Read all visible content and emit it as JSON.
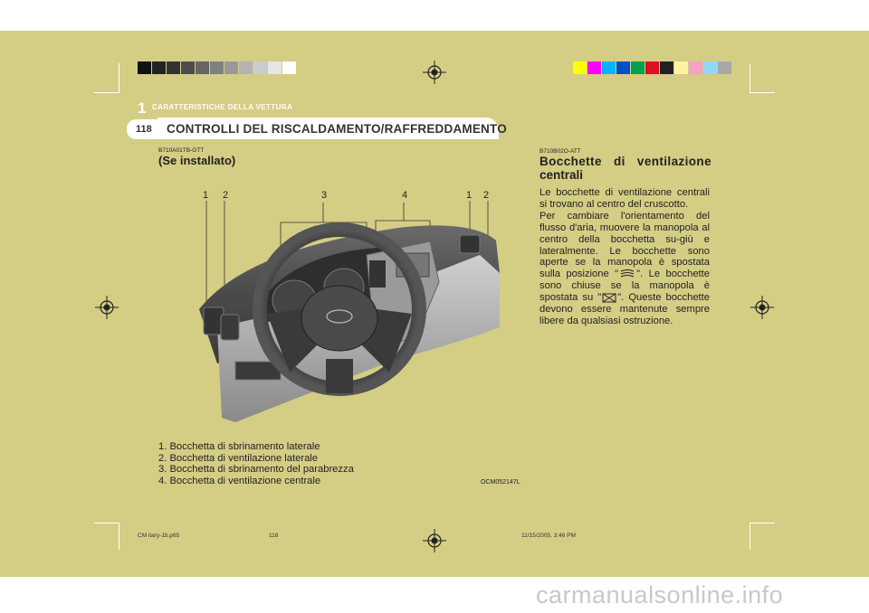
{
  "header": {
    "chapter_number": "1",
    "chapter_title": "CARATTERISTICHE DELLA VETTURA",
    "page_number": "118",
    "section_title": "CONTROLLI DEL RISCALDAMENTO/RAFFREDDAMENTO"
  },
  "left": {
    "code": "B710A01TB-GTT",
    "heading": "(Se installato)",
    "callouts": [
      "1",
      "2",
      "3",
      "4",
      "1",
      "2"
    ],
    "legend": [
      "1. Bocchetta di sbrinamento laterale",
      "2. Bocchetta di ventilazione laterale",
      "3. Bocchetta di sbrinamento del parabrezza",
      "4. Bocchetta di ventilazione centrale"
    ],
    "figure_code": "OCM052147L"
  },
  "right": {
    "code": "B710B02O-ATT",
    "heading_line1": "Bocchette di ventilazione",
    "heading_line2": "centrali",
    "para1": "Le bocchette di ventilazione centrali si trovano al centro del cruscotto.",
    "para2_a": "Per cambiare l'orientamento del flusso d'aria, muovere la manopola al centro della bocchetta su-giù e lateralmente. Le bocchette sono aperte se la manopola è spostata sulla posizione \"",
    "para2_b": "\". Le bocchette sono chiuse se la manopola è spostata su \"",
    "para2_c": "\". Queste bocchette devono essere mantenute sempre libere da qualsiasi ostruzione."
  },
  "footer": {
    "file": "CM itary-1b.p65",
    "page": "118",
    "date": "11/15/2005, 3:46 PM"
  },
  "watermark": "carmanualsonline.info",
  "colors": {
    "page_background": "#d4cd84",
    "gray_strip": [
      "#111111",
      "#222222",
      "#333333",
      "#4d4d4d",
      "#666666",
      "#808080",
      "#999999",
      "#b3b3b3",
      "#cccccc",
      "#e6e6e6",
      "#ffffff"
    ],
    "color_strip": [
      "#ffff00",
      "#ff00ff",
      "#00b4ff",
      "#0050c8",
      "#00a050",
      "#e01020",
      "#222222",
      "#fff3a0",
      "#f4a0c8",
      "#90d8f8",
      "#a8a8a8"
    ]
  }
}
